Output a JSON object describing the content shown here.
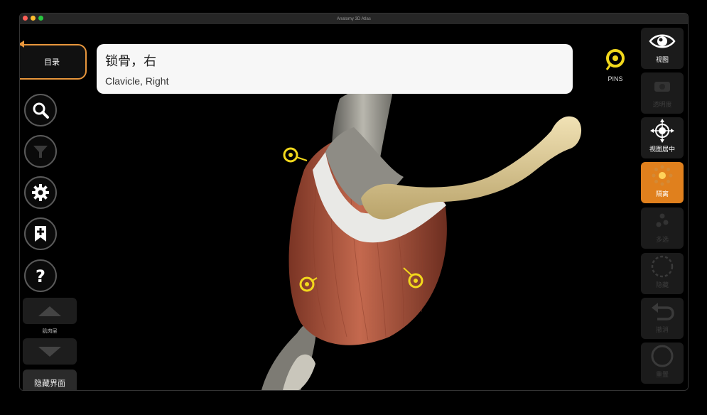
{
  "window": {
    "title": "Anatomy 3D Atlas",
    "traffic_colors": [
      "#ff5f57",
      "#febc2e",
      "#28c840"
    ]
  },
  "contents": {
    "label": "目录"
  },
  "info": {
    "title_zh": "锁骨，右",
    "title_en": "Clavicle, Right"
  },
  "left_toolbar": {
    "icons": [
      "search-icon",
      "filter-icon",
      "gear-icon",
      "bookmark-add-icon",
      "help-icon"
    ],
    "layer_label": "肌肉层",
    "hide_ui_label": "隐藏界面"
  },
  "pins": {
    "label": "PINS"
  },
  "right_toolbar": {
    "items": [
      {
        "label": "视图",
        "icon": "eye-icon",
        "state": "normal"
      },
      {
        "label": "透明度",
        "icon": "transparency-icon",
        "state": "disabled"
      },
      {
        "label": "视图居中",
        "icon": "crosshair-icon",
        "state": "normal"
      },
      {
        "label": "隔离",
        "icon": "isolate-icon",
        "state": "active"
      },
      {
        "label": "多选",
        "icon": "multi-select-icon",
        "state": "disabled"
      },
      {
        "label": "隐藏",
        "icon": "hide-icon",
        "state": "disabled"
      },
      {
        "label": "撤消",
        "icon": "undo-icon",
        "state": "disabled"
      },
      {
        "label": "重置",
        "icon": "reset-icon",
        "state": "disabled"
      }
    ]
  },
  "colors": {
    "accent_orange": "#e0801d",
    "pin_yellow": "#f2d81c",
    "bone": "#e3d29f",
    "muscle": "#b86046"
  }
}
